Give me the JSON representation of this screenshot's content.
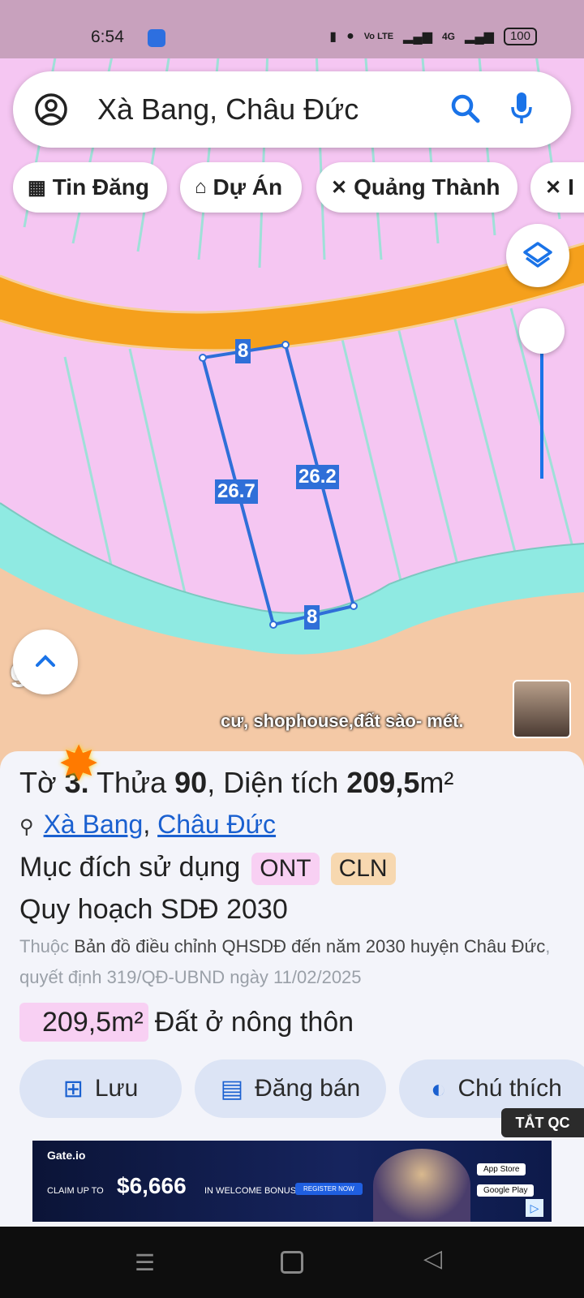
{
  "status_bar": {
    "time": "6:54",
    "battery": "100",
    "network": "4G",
    "volte": "Vo LTE"
  },
  "search": {
    "value": "Xà Bang, Châu Đức"
  },
  "chips": [
    {
      "label": "Tin Đăng",
      "icon": "table-icon"
    },
    {
      "label": "Dự Án",
      "icon": "building-icon"
    },
    {
      "label": "Quảng Thành",
      "icon": "ruler-pencil-icon"
    },
    {
      "label": "I",
      "icon": "ruler-pencil-icon"
    }
  ],
  "map": {
    "edge_labels": [
      "8",
      "26.7",
      "26.2",
      "8"
    ],
    "watermark": "gle",
    "caption": "cư, shophouse,đất sào- mét."
  },
  "sheet": {
    "title_prefix": "Tờ ",
    "title_to": "3.",
    "title_thua": " Thửa ",
    "title_thua_num": "90",
    "title_dt": ", Diện tích ",
    "title_area": "209,5",
    "title_unit": "m²",
    "location_1": "Xà Bang",
    "location_sep": ", ",
    "location_2": "Châu Đức",
    "purpose_label": "Mục đích sử dụng",
    "purpose_tags": [
      "ONT",
      "CLN"
    ],
    "plan_label": "Quy hoạch SDĐ 2030",
    "source_a": "Thuộc ",
    "source_b": "Bản đồ điều chỉnh QHSDĐ đến năm 2030 huyện Châu Đức",
    "source_c": ", quyết định 319/QĐ-UBND ngày 11/02/2025",
    "area_tag": "209,5m²",
    "area_type": "Đất ở nông thôn",
    "actions": [
      "Lưu",
      "Đăng bán",
      "Chú thích"
    ],
    "ad_off": "TẮT QC"
  },
  "ad": {
    "brand": "Gate.io",
    "claim": "CLAIM UP TO",
    "amount": "$6,666",
    "bonus": "IN WELCOME BONUS",
    "cta": "REGISTER NOW",
    "store1": "App Store",
    "store2": "Google Play"
  },
  "colors": {
    "accent": "#1a73e8",
    "land_pink": "#f4c4f0",
    "road_orange": "#f5a21c",
    "river_teal": "#8fe8e0",
    "ont_tag": "#f8d0f3",
    "cln_tag": "#f7d8b0"
  }
}
